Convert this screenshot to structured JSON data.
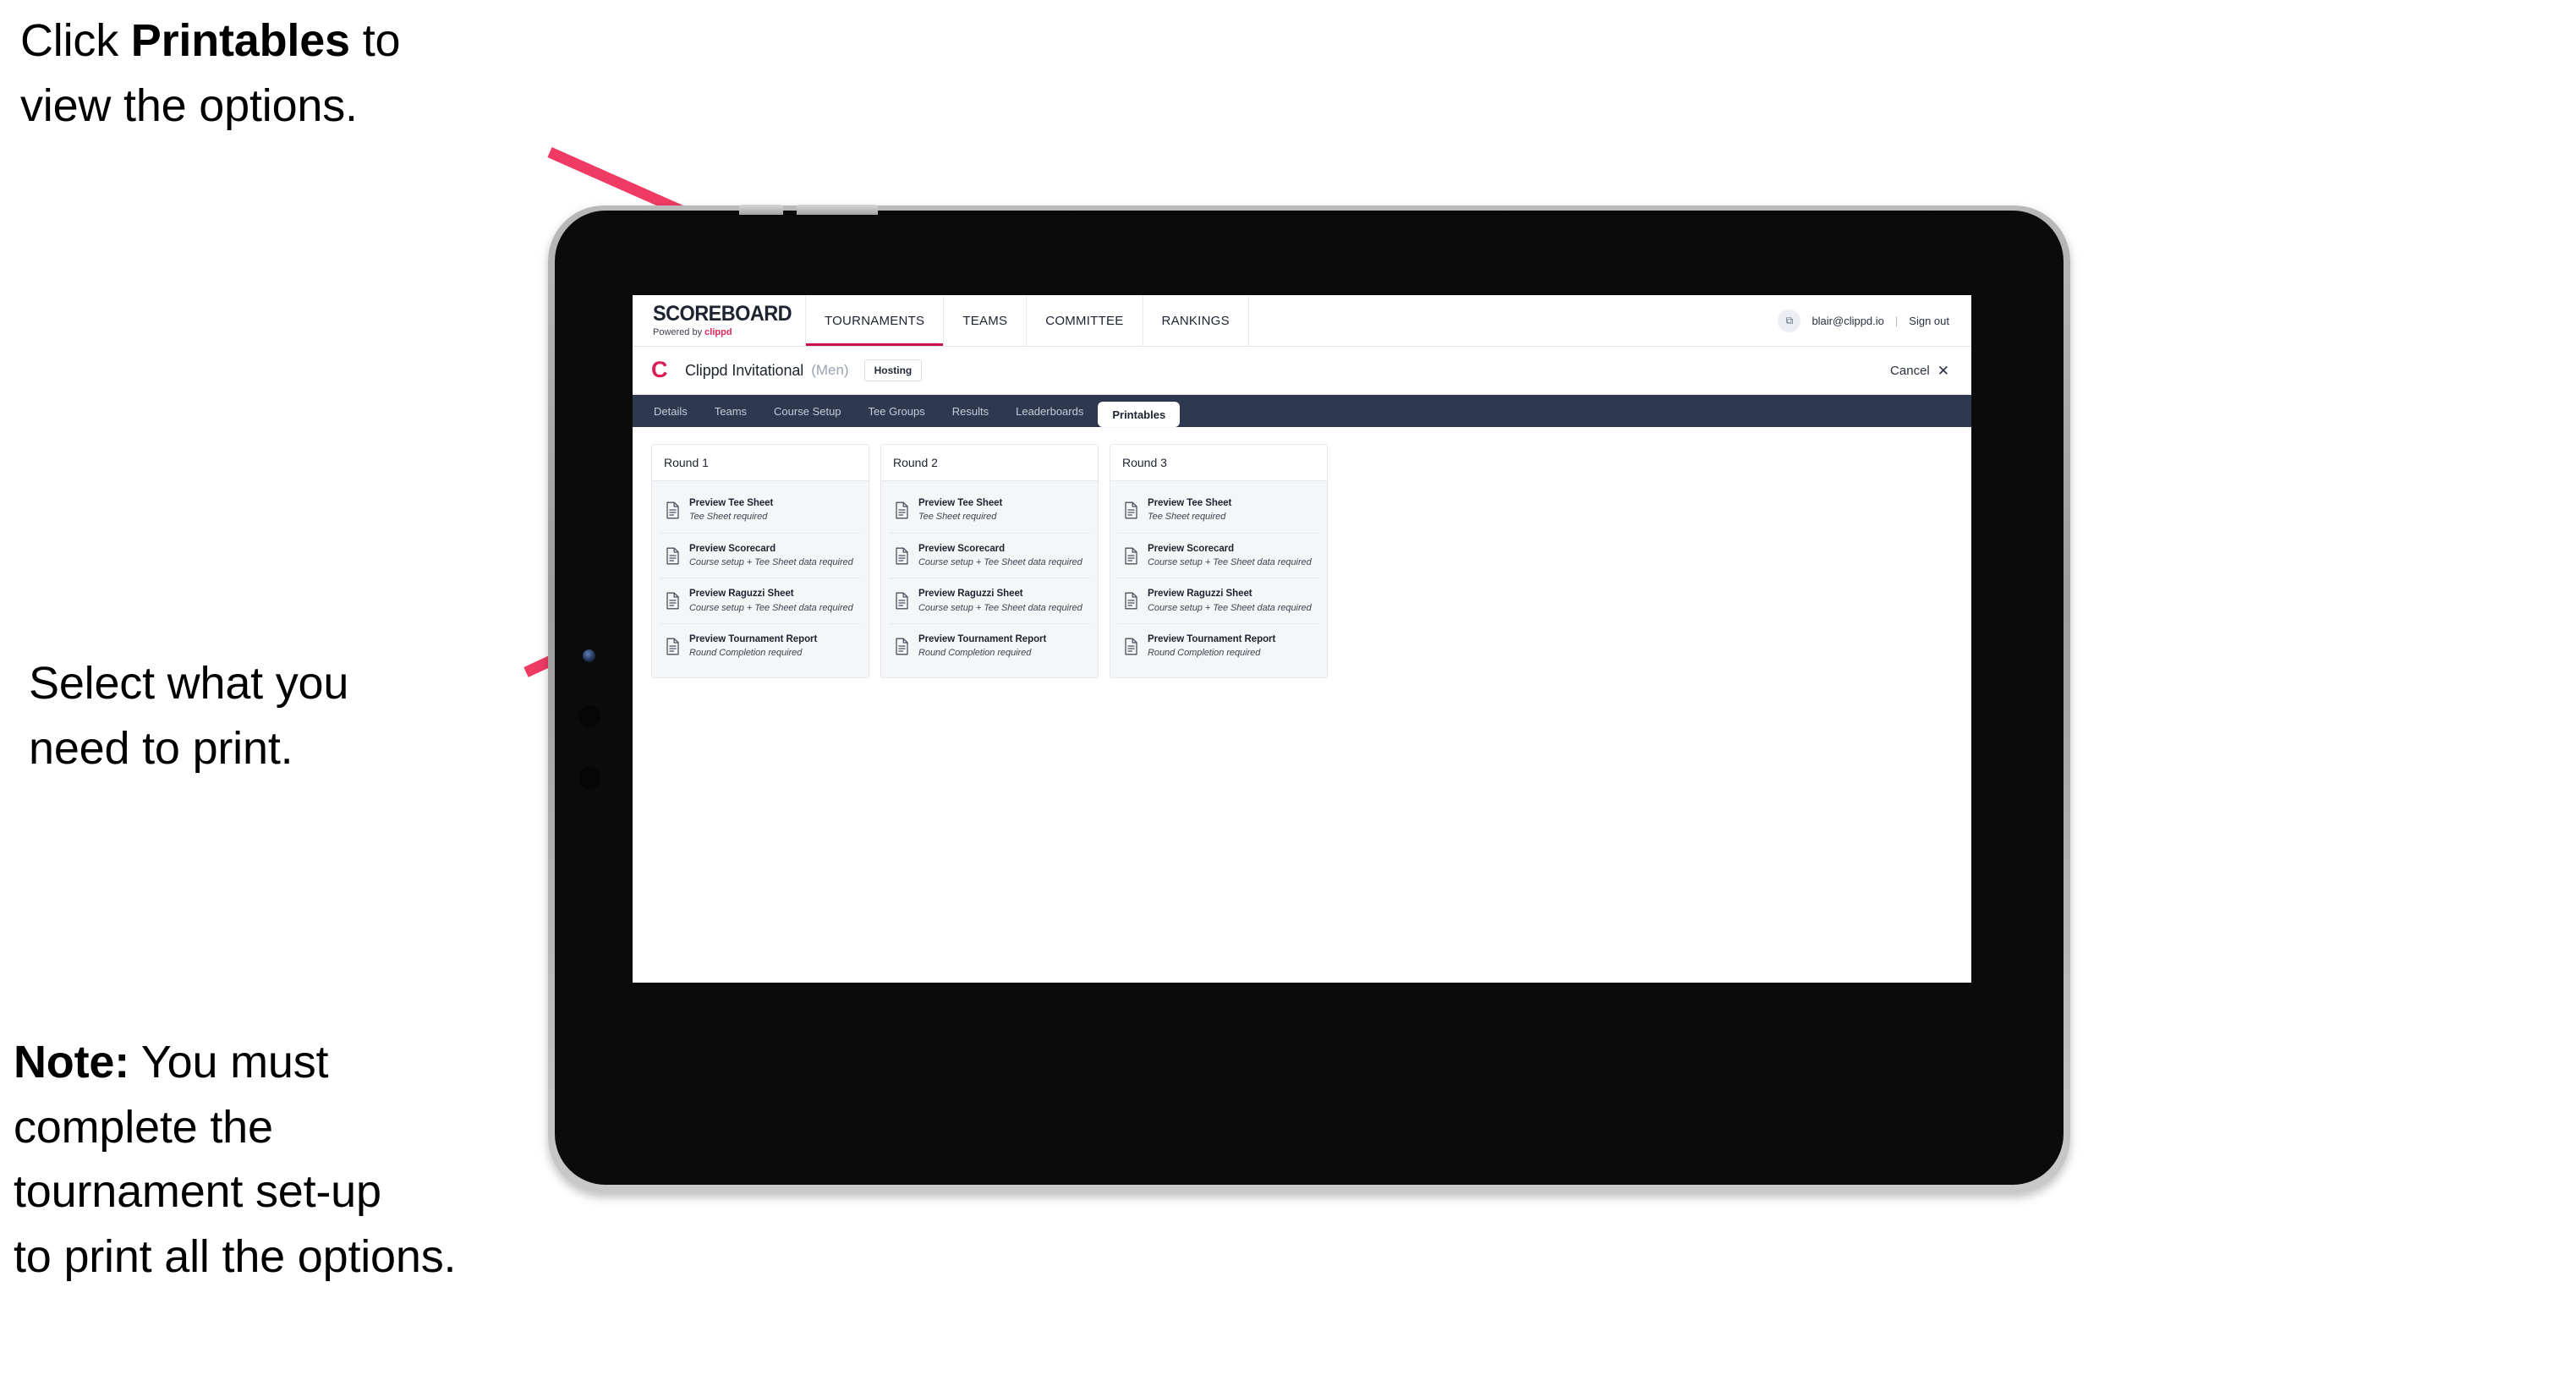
{
  "annotations": {
    "click_printables": "Click Printables to\nview the options.",
    "click_printables_prefix": "Click ",
    "click_printables_bold": "Printables",
    "click_printables_suffix": " to\nview the options.",
    "select_print": "Select what you\n need to print.",
    "note_prefix": "Note:",
    "note_body": " You must\ncomplete the\ntournament set-up\nto print all the options.",
    "arrow_color": "#ef3b64"
  },
  "browser": {
    "topbar": {
      "logo_wordmark": "SCOREBOARD",
      "logo_powered_prefix": "Powered by ",
      "logo_brand": "clippd",
      "nav": [
        {
          "label": "TOURNAMENTS",
          "active": true
        },
        {
          "label": "TEAMS",
          "active": false
        },
        {
          "label": "COMMITTEE",
          "active": false
        },
        {
          "label": "RANKINGS",
          "active": false
        }
      ],
      "account": {
        "avatar_glyph": "⧉",
        "email": "blair@clippd.io",
        "separator": "|",
        "sign_out": "Sign out"
      }
    },
    "subheader": {
      "brand_mark": "C",
      "tournament_name": "Clippd Invitational",
      "gender": "(Men)",
      "status_chip": "Hosting",
      "cancel_label": "Cancel",
      "cancel_icon": "✕"
    },
    "tabs": [
      {
        "label": "Details",
        "active": false
      },
      {
        "label": "Teams",
        "active": false
      },
      {
        "label": "Course Setup",
        "active": false
      },
      {
        "label": "Tee Groups",
        "active": false
      },
      {
        "label": "Results",
        "active": false
      },
      {
        "label": "Leaderboards",
        "active": false
      },
      {
        "label": "Printables",
        "active": true
      }
    ],
    "rounds": [
      {
        "title": "Round 1",
        "items": [
          {
            "title": "Preview Tee Sheet",
            "subtitle": "Tee Sheet required"
          },
          {
            "title": "Preview Scorecard",
            "subtitle": "Course setup + Tee Sheet data required"
          },
          {
            "title": "Preview Raguzzi Sheet",
            "subtitle": "Course setup + Tee Sheet data required"
          },
          {
            "title": "Preview Tournament Report",
            "subtitle": "Round Completion required"
          }
        ]
      },
      {
        "title": "Round 2",
        "items": [
          {
            "title": "Preview Tee Sheet",
            "subtitle": "Tee Sheet required"
          },
          {
            "title": "Preview Scorecard",
            "subtitle": "Course setup + Tee Sheet data required"
          },
          {
            "title": "Preview Raguzzi Sheet",
            "subtitle": "Course setup + Tee Sheet data required"
          },
          {
            "title": "Preview Tournament Report",
            "subtitle": "Round Completion required"
          }
        ]
      },
      {
        "title": "Round 3",
        "items": [
          {
            "title": "Preview Tee Sheet",
            "subtitle": "Tee Sheet required"
          },
          {
            "title": "Preview Scorecard",
            "subtitle": "Course setup + Tee Sheet data required"
          },
          {
            "title": "Preview Raguzzi Sheet",
            "subtitle": "Course setup + Tee Sheet data required"
          },
          {
            "title": "Preview Tournament Report",
            "subtitle": "Round Completion required"
          }
        ]
      }
    ]
  },
  "colors": {
    "accent_pink": "#ef3b64",
    "brand_crimson": "#dd1b54",
    "nav_active_underline": "#c5104a",
    "tabstrip_bg": "#2e3950",
    "card_body_bg": "#f5f6f8"
  }
}
